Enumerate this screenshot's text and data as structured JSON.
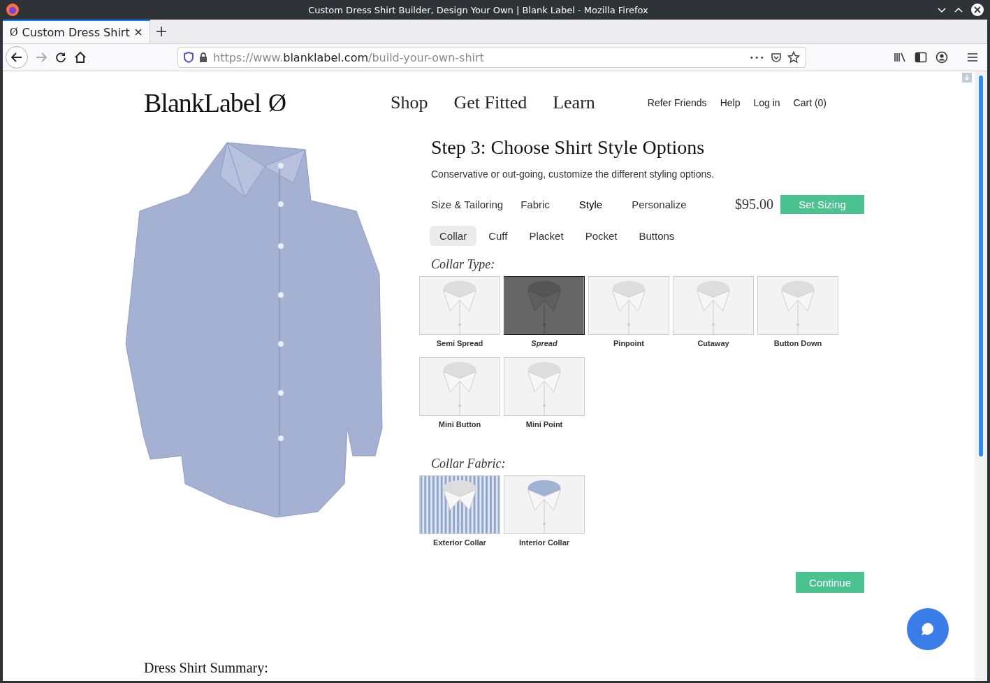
{
  "browser": {
    "window_title": "Custom Dress Shirt Builder, Design Your Own | Blank Label - Mozilla Firefox",
    "tabs": [
      {
        "icon_glyph": "Ø",
        "title": "Custom Dress Shirt",
        "selected": true
      }
    ],
    "url": {
      "scheme": "https://www.",
      "domain": "blanklabel.com",
      "path": "/build-your-own-shirt"
    },
    "more_glyph": "•••"
  },
  "header": {
    "logo": "BlankLabel",
    "logo_mark": "Ø",
    "nav": [
      "Shop",
      "Get Fitted",
      "Learn"
    ],
    "links": [
      "Refer Friends",
      "Help",
      "Log in",
      "Cart (0)"
    ]
  },
  "builder": {
    "title": "Step 3: Choose Shirt Style Options",
    "subtitle": "Conservative or out-going, customize the different styling options.",
    "steps": [
      {
        "label": "Size & Tailoring",
        "selected": false
      },
      {
        "label": "Fabric",
        "selected": false
      },
      {
        "label": "Style",
        "selected": true
      },
      {
        "label": "Personalize",
        "selected": false
      }
    ],
    "price": "$95.00",
    "set_sizing": "Set Sizing",
    "subtabs": [
      {
        "label": "Collar",
        "selected": true
      },
      {
        "label": "Cuff",
        "selected": false
      },
      {
        "label": "Placket",
        "selected": false
      },
      {
        "label": "Pocket",
        "selected": false
      },
      {
        "label": "Buttons",
        "selected": false
      }
    ],
    "sections": [
      {
        "heading": "Collar Type:",
        "options": [
          {
            "label": "Semi Spread",
            "kind": "plain",
            "selected": false
          },
          {
            "label": "Spread",
            "kind": "plain",
            "selected": true
          },
          {
            "label": "Pinpoint",
            "kind": "plain",
            "selected": false
          },
          {
            "label": "Cutaway",
            "kind": "plain",
            "selected": false
          },
          {
            "label": "Button Down",
            "kind": "plain",
            "selected": false
          },
          {
            "label": "Mini Button",
            "kind": "plain",
            "selected": false
          },
          {
            "label": "Mini Point",
            "kind": "plain",
            "selected": false
          }
        ]
      },
      {
        "heading": "Collar Fabric:",
        "options": [
          {
            "label": "Exterior Collar",
            "kind": "striped",
            "selected": false
          },
          {
            "label": "Interior Collar",
            "kind": "plain",
            "selected": false
          }
        ]
      }
    ],
    "continue": "Continue"
  },
  "summary_title": "Dress Shirt Summary:"
}
